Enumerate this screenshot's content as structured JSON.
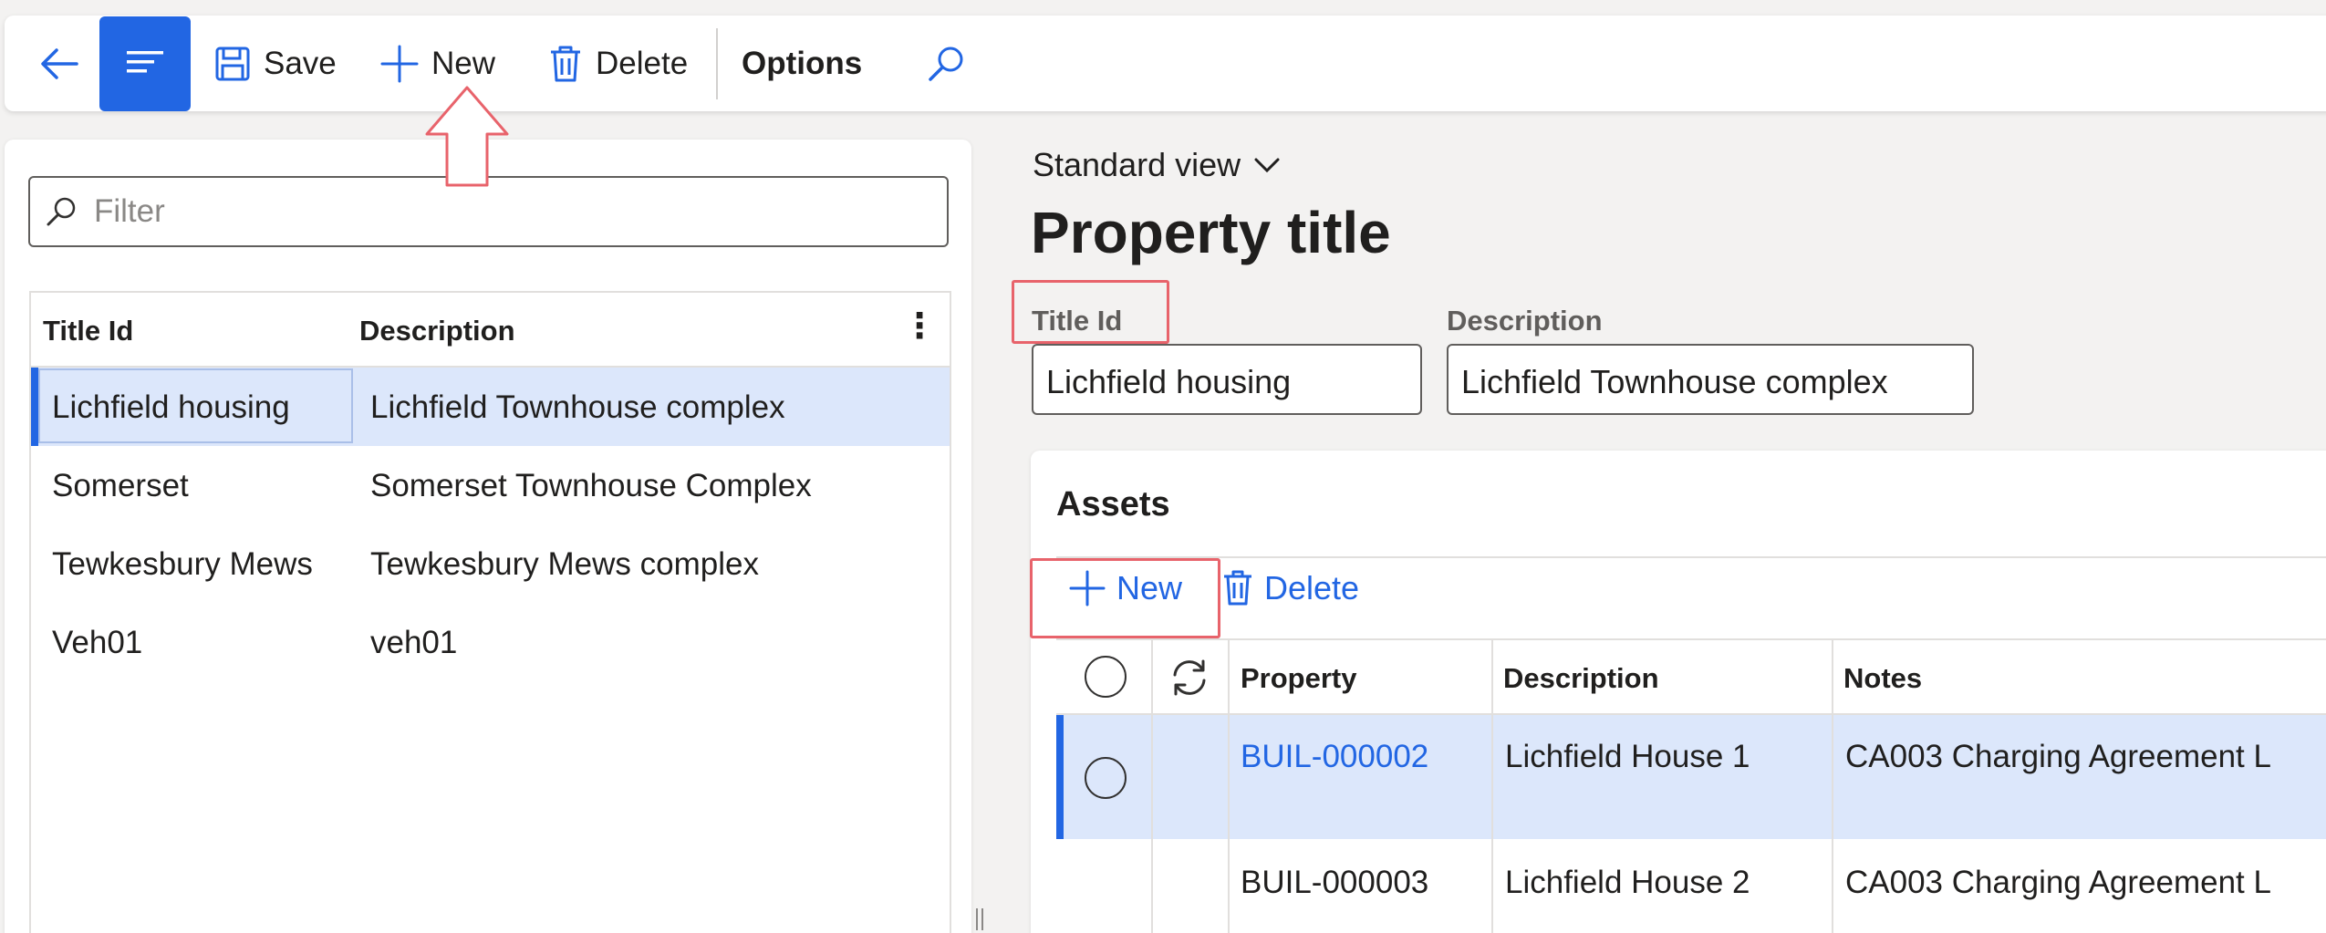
{
  "toolbar": {
    "save_label": "Save",
    "new_label": "New",
    "delete_label": "Delete",
    "options_label": "Options",
    "accent_color": "#2266e3"
  },
  "filter": {
    "placeholder": "Filter"
  },
  "list": {
    "columns": [
      "Title Id",
      "Description"
    ],
    "rows": [
      {
        "title_id": "Lichfield housing",
        "description": "Lichfield Townhouse complex"
      },
      {
        "title_id": "Somerset",
        "description": "Somerset Townhouse Complex"
      },
      {
        "title_id": "Tewkesbury Mews",
        "description": "Tewkesbury Mews complex"
      },
      {
        "title_id": "Veh01",
        "description": "veh01"
      }
    ]
  },
  "detail": {
    "view_name": "Standard view",
    "page_title": "Property title",
    "title_id_label": "Title Id",
    "title_id_value": "Lichfield housing",
    "description_label": "Description",
    "description_value": "Lichfield Townhouse complex"
  },
  "assets": {
    "section_title": "Assets",
    "new_label": "New",
    "delete_label": "Delete",
    "columns": [
      "Property",
      "Description",
      "Notes"
    ],
    "rows": [
      {
        "property": "BUIL-000002",
        "description": "Lichfield House 1",
        "notes": "CA003 Charging Agreement L"
      },
      {
        "property": "BUIL-000003",
        "description": "Lichfield House 2",
        "notes": "CA003 Charging Agreement L"
      }
    ]
  }
}
